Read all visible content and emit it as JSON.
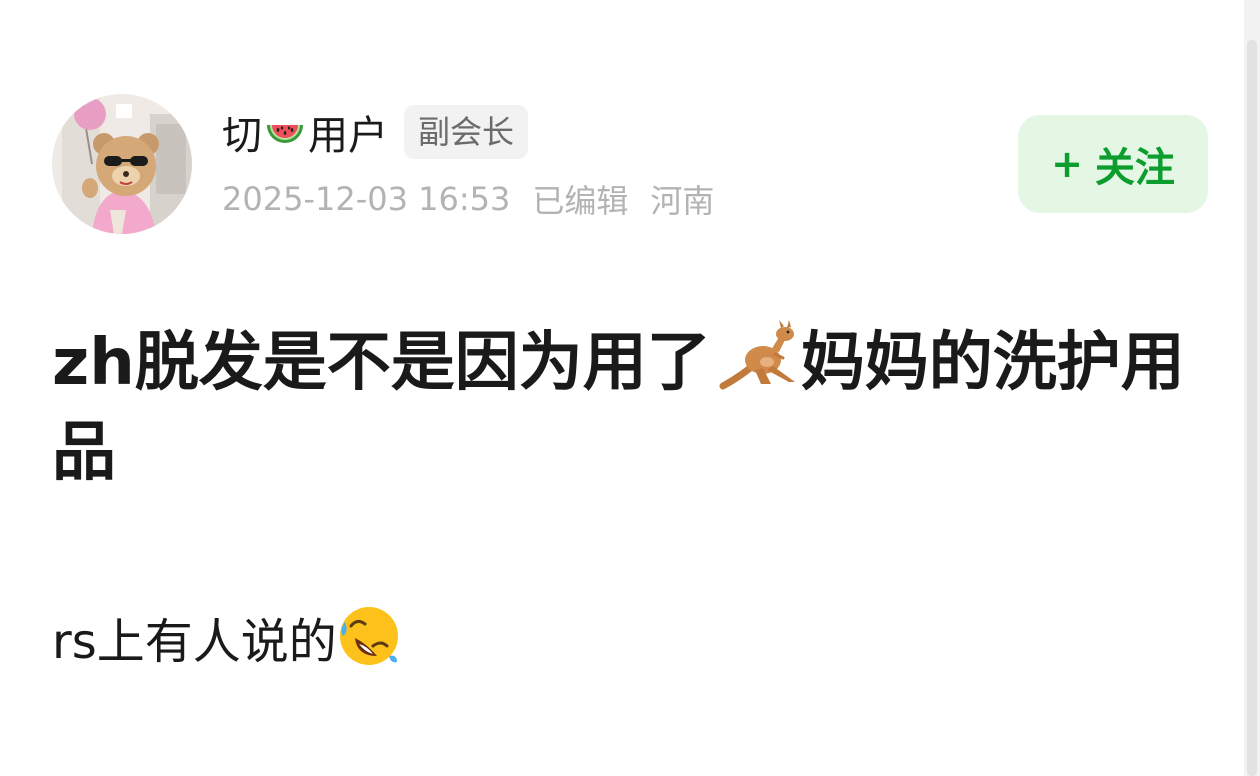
{
  "author": {
    "name_before_icon": "切",
    "name_icon": "watermelon-emoji",
    "name_after_icon": "用户",
    "role": "副会长",
    "timestamp": "2025-12-03 16:53",
    "edited": "已编辑",
    "location": "河南"
  },
  "follow": {
    "plus": "+",
    "label": "关注"
  },
  "post": {
    "title_before_icon": "zh脱发是不是因为用了",
    "title_icon": "kangaroo-emoji",
    "title_after_icon": "妈妈的洗护用品",
    "body_text": "rs上有人说的",
    "body_icon": "rolling-on-floor-laughing-emoji"
  },
  "colors": {
    "follow_text": "#0c9d2e",
    "follow_bg": "#e4f6e4",
    "meta_text": "#b3b3b3",
    "badge_bg": "#f2f2f2"
  }
}
